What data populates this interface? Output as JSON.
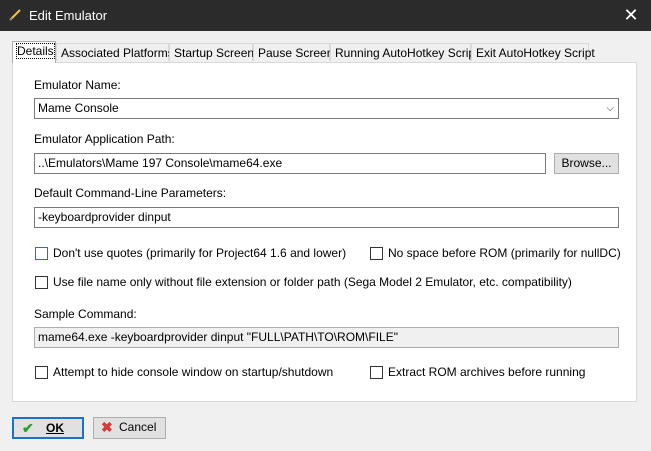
{
  "window": {
    "title": "Edit Emulator",
    "close_glyph": "✕"
  },
  "tabs": [
    {
      "label": "Details",
      "active": true
    },
    {
      "label": "Associated Platforms"
    },
    {
      "label": "Startup Screen"
    },
    {
      "label": "Pause Screen"
    },
    {
      "label": "Running AutoHotkey Script"
    },
    {
      "label": "Exit AutoHotkey Script"
    }
  ],
  "details": {
    "emulator_name_label": "Emulator Name:",
    "emulator_name_value": "Mame Console",
    "app_path_label": "Emulator Application Path:",
    "app_path_value": "..\\Emulators\\Mame 197 Console\\mame64.exe",
    "browse_label": "Browse...",
    "cmdline_label": "Default Command-Line Parameters:",
    "cmdline_value": "-keyboardprovider dinput",
    "dont_use_quotes": {
      "label": "Don't use quotes (primarily for Project64 1.6 and lower)",
      "checked": false
    },
    "no_space_before_rom": {
      "label": "No space before ROM (primarily for nullDC)",
      "checked": false
    },
    "use_file_name_only": {
      "label": "Use file name only without file extension or folder path (Sega Model 2 Emulator, etc. compatibility)",
      "checked": false
    },
    "sample_command_label": "Sample Command:",
    "sample_command_value": "mame64.exe -keyboardprovider dinput \"FULL\\PATH\\TO\\ROM\\FILE\"",
    "hide_console": {
      "label": "Attempt to hide console window on startup/shutdown",
      "checked": false
    },
    "extract_rom": {
      "label": "Extract ROM archives before running",
      "checked": false
    }
  },
  "footer": {
    "ok_label": "OK",
    "cancel_label": "Cancel",
    "ok_icon": "checkmark-icon",
    "cancel_icon": "x-icon"
  },
  "colors": {
    "titlebar": "#2b2b2b",
    "accent": "#1a73c7",
    "ok_icon": "#2e9e2e",
    "cancel_icon": "#d23b3b"
  }
}
